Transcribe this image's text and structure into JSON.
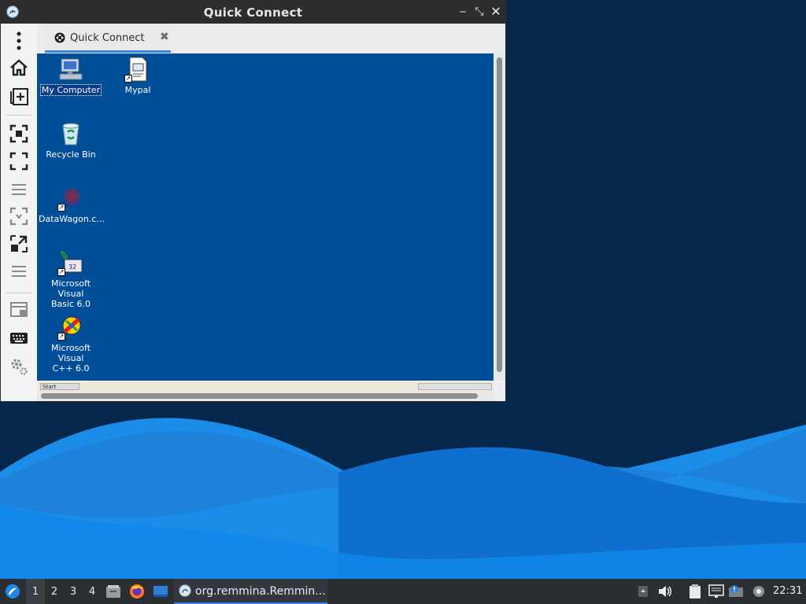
{
  "window": {
    "title": "Quick Connect",
    "buttons": {
      "minimize": "‒",
      "maximize": "⤡",
      "close": "✕"
    }
  },
  "toolbar": {
    "items": [
      {
        "name": "menu-icon"
      },
      {
        "name": "home-icon"
      },
      {
        "name": "new-connection-icon"
      },
      {
        "name": "fit-window-icon"
      },
      {
        "name": "fullscreen-icon"
      },
      {
        "name": "menu-lines-icon"
      },
      {
        "name": "dynamic-resolution-icon"
      },
      {
        "name": "scaled-mode-icon"
      },
      {
        "name": "menu-lines-icon"
      },
      {
        "name": "multi-monitor-icon"
      },
      {
        "name": "keyboard-icon"
      },
      {
        "name": "settings-gear-icon"
      }
    ]
  },
  "tab": {
    "label": "Quick Connect",
    "close": "✖"
  },
  "remote_desktop": {
    "background": "#004e98",
    "icons": [
      {
        "label": "My Computer",
        "selected": true
      },
      {
        "label": "Mypal"
      },
      {
        "label": "Recycle Bin"
      },
      {
        "label": "DataWagon.c..."
      },
      {
        "label_line1": "Microsoft Visual",
        "label_line2": "Basic 6.0"
      },
      {
        "label_line1": "Microsoft Visual",
        "label_line2": "C++ 6.0"
      }
    ],
    "start_label": "Start"
  },
  "panel": {
    "workspaces": [
      "1",
      "2",
      "3",
      "4"
    ],
    "active_workspace": "1",
    "task_label": "org.remmina.Remmin...",
    "clock": "22:31"
  },
  "colors": {
    "accent": "#3584e4",
    "panel_bg": "#2b2e33",
    "titlebar_bg": "#2d2d2d"
  }
}
